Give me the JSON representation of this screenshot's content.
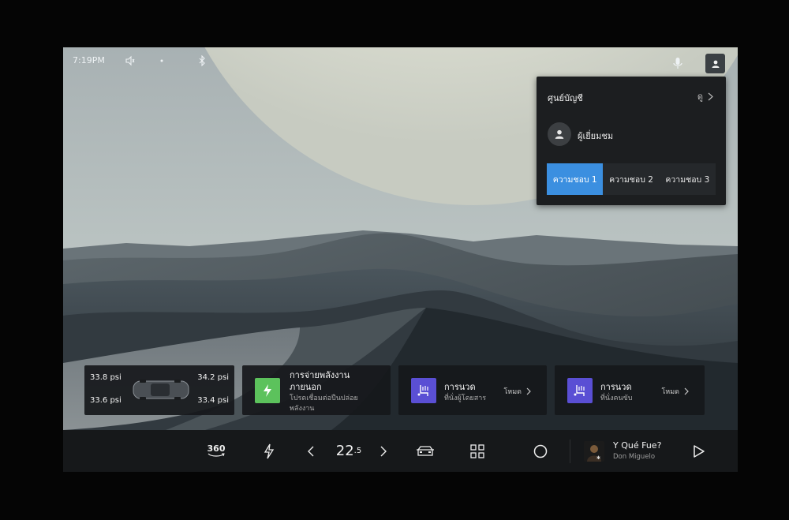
{
  "status": {
    "time": "7:19PM",
    "icons": [
      "volume-icon",
      "dot-icon",
      "bluetooth-icon",
      "mic-icon",
      "profile-icon"
    ]
  },
  "account_panel": {
    "title": "ศูนย์บัญชี",
    "view_label": "ดู",
    "guest_label": "ผู้เยี่ยมชม",
    "preferences": [
      "ความชอบ 1",
      "ความชอบ 2",
      "ความชอบ 3"
    ],
    "active_preference": 0,
    "accent_color": "#3b8fe0"
  },
  "tires": {
    "front_left": "33.8 psi",
    "front_right": "34.2 psi",
    "rear_left": "33.6 psi",
    "rear_right": "33.4 psi"
  },
  "cards": {
    "charging": {
      "title": "การจ่ายพลังงาน\nภายนอก",
      "subtitle": "โปรดเชื่อมต่อปืนปล่อย\nพลังงาน",
      "icon_color": "#5cc25c"
    },
    "massage_passenger": {
      "title": "การนวด",
      "subtitle": "ที่นั่งผู้โดยสาร",
      "mode_label": "โหมด",
      "icon_color": "#5a4fd4"
    },
    "massage_driver": {
      "title": "การนวด",
      "subtitle": "ที่นั่งคนขับ",
      "mode_label": "โหมด",
      "icon_color": "#5a4fd4"
    }
  },
  "dock": {
    "view_360_label": "360",
    "temperature_main": "22",
    "temperature_decimal": ".5",
    "media": {
      "title": "Y Qué Fue?",
      "artist": "Don Miguelo"
    }
  }
}
